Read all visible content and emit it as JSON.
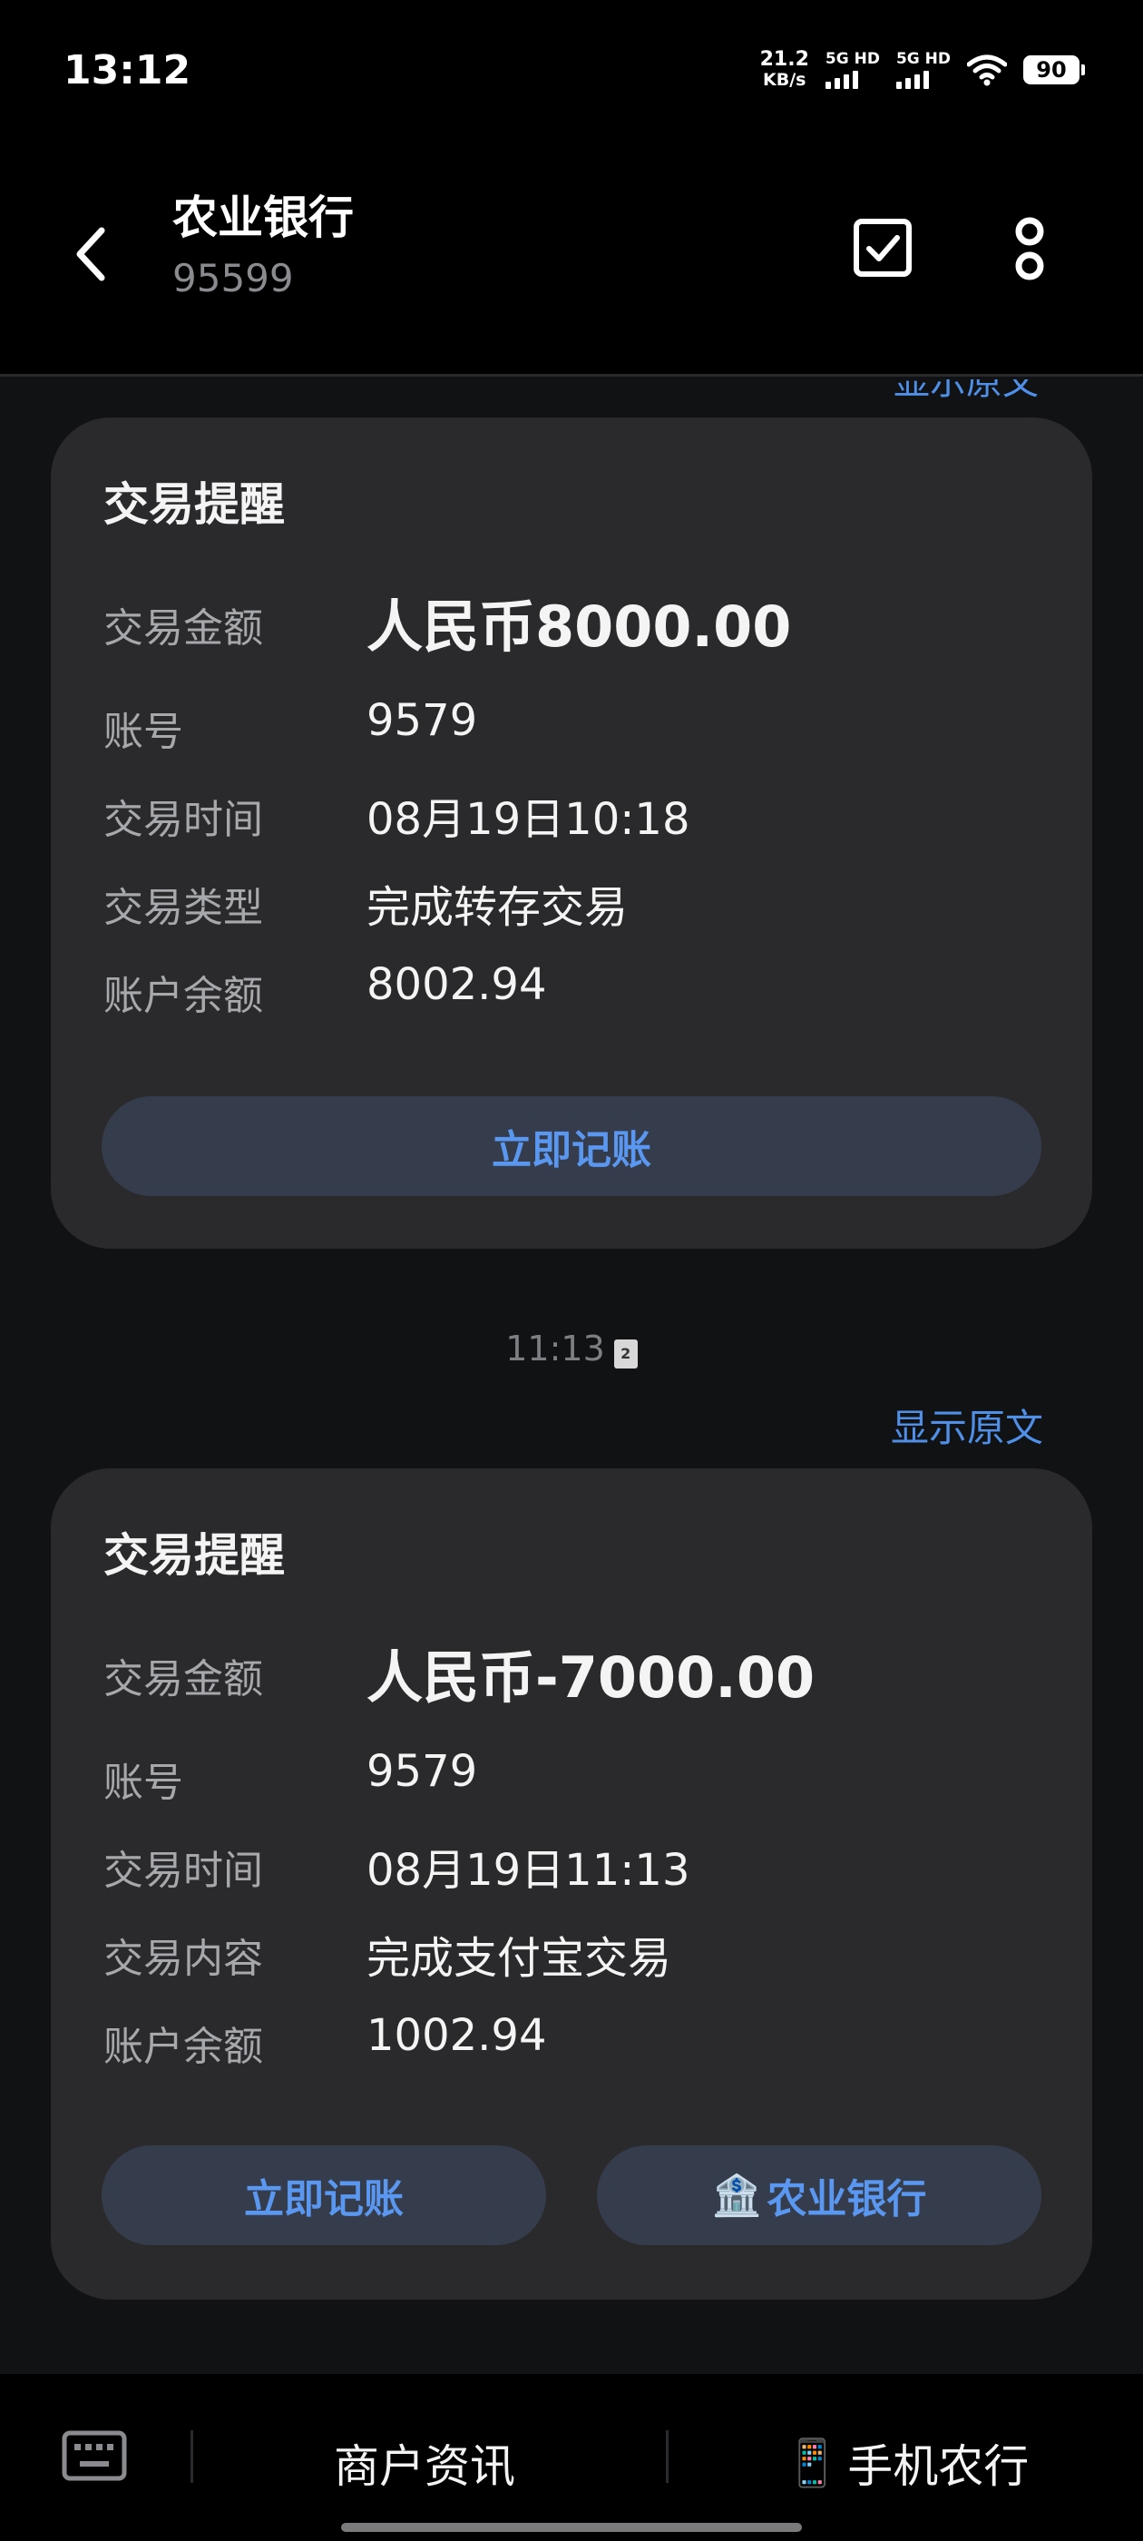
{
  "status_bar": {
    "time": "13:12",
    "speed_value": "21.2",
    "speed_unit": "KB/s",
    "sim1_label": "5G HD",
    "sim2_label": "5G HD",
    "battery": "90"
  },
  "header": {
    "title": "农业银行",
    "subtitle": "95599"
  },
  "clipped_link": "显示原文",
  "messages": [
    {
      "title": "交易提醒",
      "rows": [
        {
          "label": "交易金额",
          "value": "人民币8000.00"
        },
        {
          "label": "账号",
          "value": "9579"
        },
        {
          "label": "交易时间",
          "value": "08月19日10:18"
        },
        {
          "label": "交易类型",
          "value": "完成转存交易"
        },
        {
          "label": "账户余额",
          "value": "8002.94"
        }
      ],
      "buttons": [
        "立即记账"
      ]
    },
    {
      "timestamp": "11:13",
      "sim_slot": "2",
      "show_original": "显示原文",
      "title": "交易提醒",
      "rows": [
        {
          "label": "交易金额",
          "value": "人民币-7000.00"
        },
        {
          "label": "账号",
          "value": "9579"
        },
        {
          "label": "交易时间",
          "value": "08月19日11:13"
        },
        {
          "label": "交易内容",
          "value": "完成支付宝交易"
        },
        {
          "label": "账户余额",
          "value": "1002.94"
        }
      ],
      "buttons": [
        "立即记账",
        "农业银行"
      ],
      "button_icons": [
        "",
        "🏦"
      ]
    }
  ],
  "bottom_menu": {
    "item1": "商户资讯",
    "item2": "手机农行",
    "item2_icon": "📱"
  }
}
